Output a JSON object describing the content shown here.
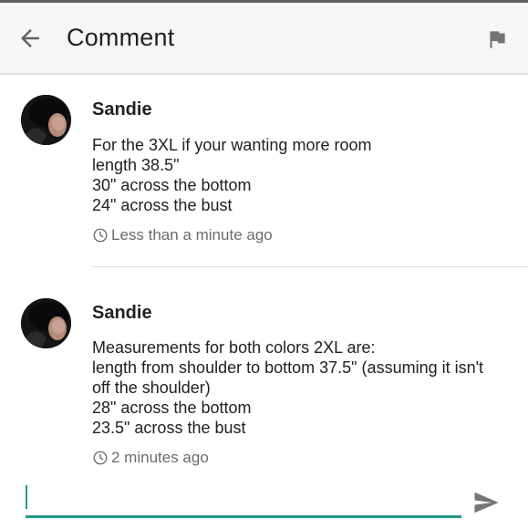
{
  "header": {
    "title": "Comment",
    "back_icon": "arrow-back-icon",
    "flag_icon": "flag-icon"
  },
  "comments": [
    {
      "author": "Sandie",
      "lines": [
        "For the 3XL if your wanting more room",
        "length 38.5\"",
        "30\" across the bottom",
        "24\" across the bust"
      ],
      "time": "Less than a minute ago"
    },
    {
      "author": "Sandie",
      "lines": [
        "Measurements for both colors 2XL are:",
        "length from shoulder to bottom 37.5\" (assuming it isn't",
        "off the shoulder)",
        "28\" across the bottom",
        "23.5\" across the bust"
      ],
      "time": "2 minutes ago"
    }
  ],
  "composer": {
    "value": "",
    "send_icon": "send-icon"
  },
  "colors": {
    "accent": "#1e9a86",
    "appbar_bg": "#f6f6f6",
    "secondary_text": "#6b6b6b"
  }
}
